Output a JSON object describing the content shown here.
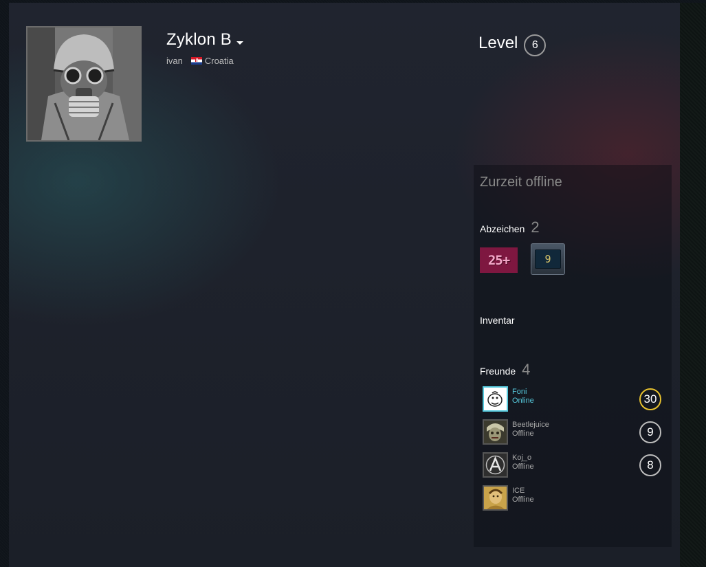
{
  "profile": {
    "persona_name": "Zyklon B",
    "real_name": "ivan",
    "country": "Croatia",
    "level_label": "Level",
    "level": "6"
  },
  "rightcol": {
    "status": "Zurzeit offline",
    "badges": {
      "label": "Abzeichen",
      "count": "2",
      "items": [
        {
          "icon": "years-of-service-badge-icon",
          "text": "25+"
        },
        {
          "icon": "game-badge-icon",
          "text": "9"
        }
      ]
    },
    "inventory": {
      "label": "Inventar"
    },
    "friends": {
      "label": "Freunde",
      "count": "4",
      "list": [
        {
          "name": "Foni",
          "status": "Online",
          "level": "30"
        },
        {
          "name": "Beetlejuice",
          "status": "Offline",
          "level": "9"
        },
        {
          "name": "Koj_o",
          "status": "Offline",
          "level": "8"
        },
        {
          "name": "ICE",
          "status": "Offline",
          "level": ""
        }
      ]
    }
  },
  "colors": {
    "online": "#57cbde",
    "offline_text": "#a9a9a9",
    "gold_level": "#e8c22e"
  }
}
